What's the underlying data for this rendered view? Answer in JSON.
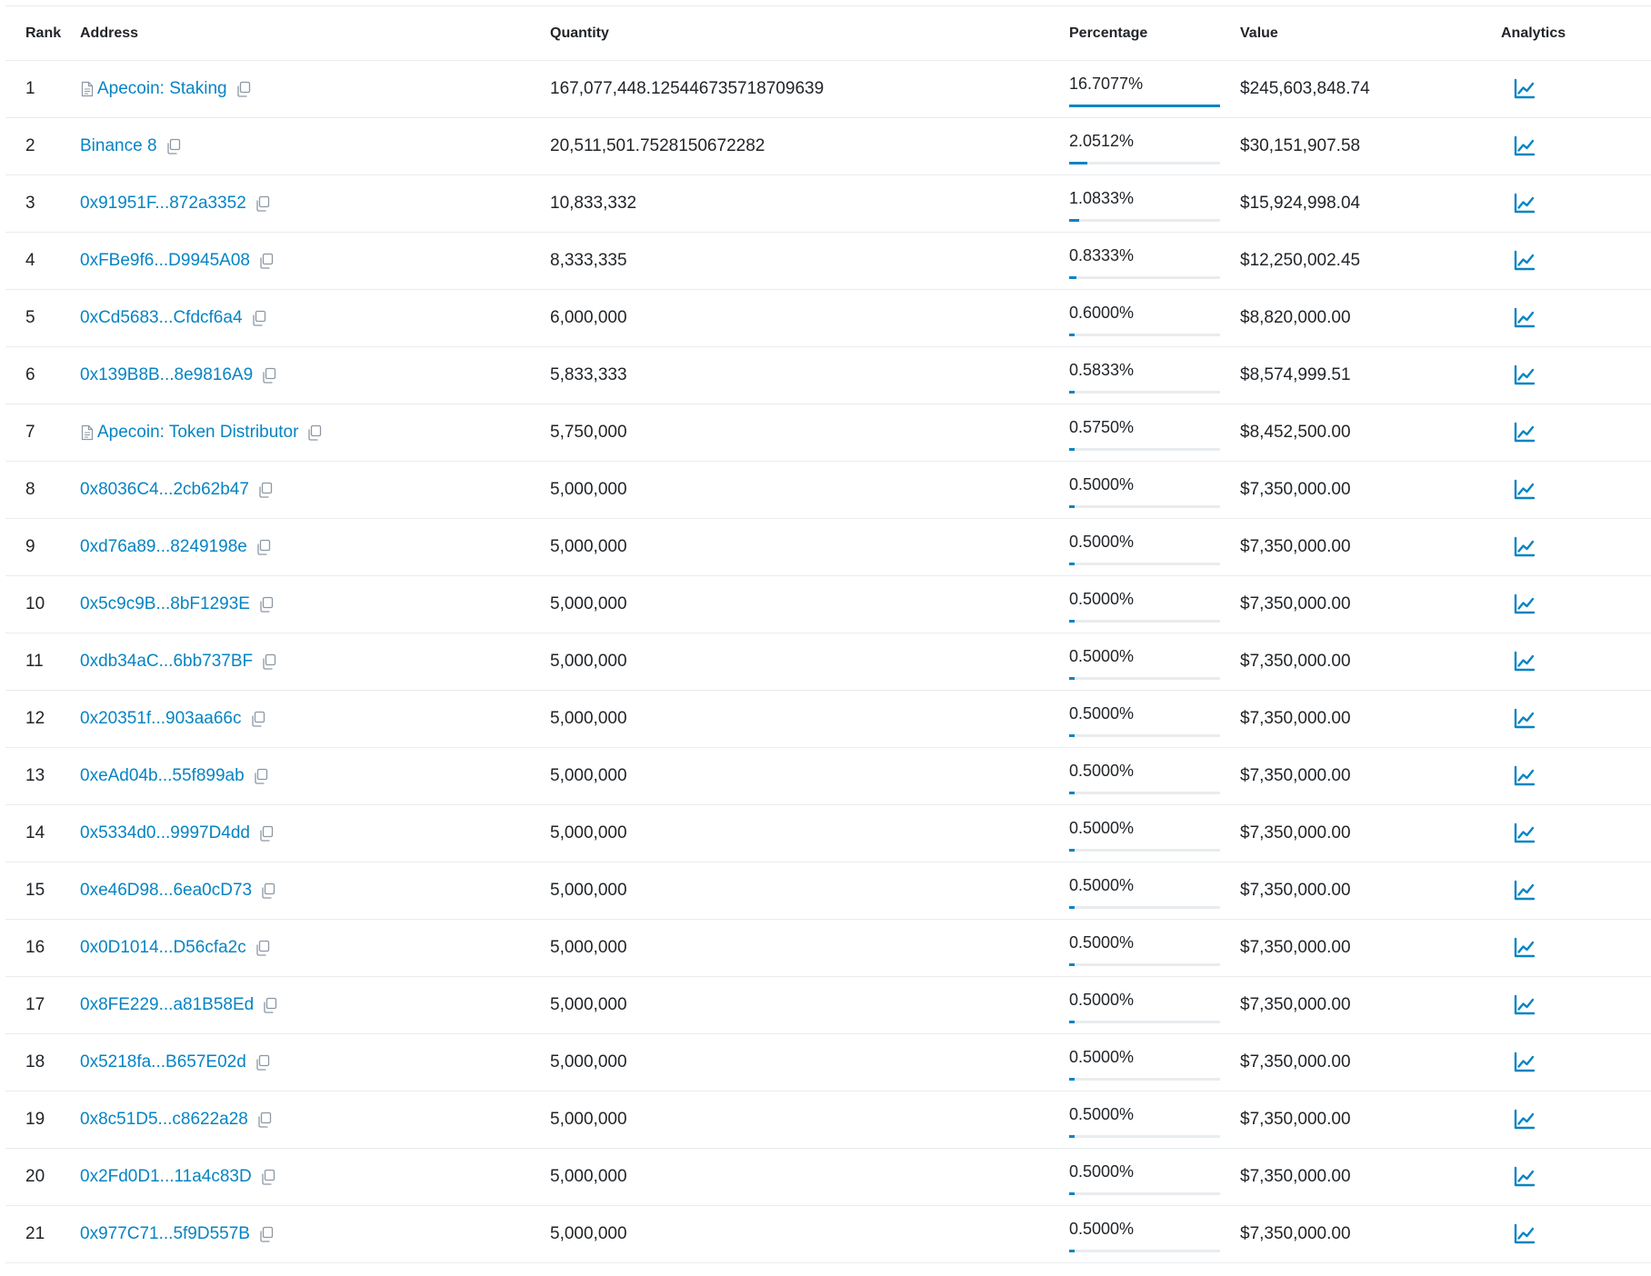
{
  "table": {
    "headers": {
      "rank": "Rank",
      "address": "Address",
      "quantity": "Quantity",
      "percentage": "Percentage",
      "value": "Value",
      "analytics": "Analytics"
    },
    "rows": [
      {
        "rank": "1",
        "address": "Apecoin: Staking",
        "is_contract": true,
        "quantity": "167,077,448.125446735718709639",
        "percentage": "16.7077%",
        "pct_value": 16.7077,
        "value": "$245,603,848.74"
      },
      {
        "rank": "2",
        "address": "Binance 8",
        "is_contract": false,
        "quantity": "20,511,501.7528150672282",
        "percentage": "2.0512%",
        "pct_value": 2.0512,
        "value": "$30,151,907.58"
      },
      {
        "rank": "3",
        "address": "0x91951F...872a3352",
        "is_contract": false,
        "quantity": "10,833,332",
        "percentage": "1.0833%",
        "pct_value": 1.0833,
        "value": "$15,924,998.04"
      },
      {
        "rank": "4",
        "address": "0xFBe9f6...D9945A08",
        "is_contract": false,
        "quantity": "8,333,335",
        "percentage": "0.8333%",
        "pct_value": 0.8333,
        "value": "$12,250,002.45"
      },
      {
        "rank": "5",
        "address": "0xCd5683...Cfdcf6a4",
        "is_contract": false,
        "quantity": "6,000,000",
        "percentage": "0.6000%",
        "pct_value": 0.6,
        "value": "$8,820,000.00"
      },
      {
        "rank": "6",
        "address": "0x139B8B...8e9816A9",
        "is_contract": false,
        "quantity": "5,833,333",
        "percentage": "0.5833%",
        "pct_value": 0.5833,
        "value": "$8,574,999.51"
      },
      {
        "rank": "7",
        "address": "Apecoin: Token Distributor",
        "is_contract": true,
        "quantity": "5,750,000",
        "percentage": "0.5750%",
        "pct_value": 0.575,
        "value": "$8,452,500.00"
      },
      {
        "rank": "8",
        "address": "0x8036C4...2cb62b47",
        "is_contract": false,
        "quantity": "5,000,000",
        "percentage": "0.5000%",
        "pct_value": 0.5,
        "value": "$7,350,000.00"
      },
      {
        "rank": "9",
        "address": "0xd76a89...8249198e",
        "is_contract": false,
        "quantity": "5,000,000",
        "percentage": "0.5000%",
        "pct_value": 0.5,
        "value": "$7,350,000.00"
      },
      {
        "rank": "10",
        "address": "0x5c9c9B...8bF1293E",
        "is_contract": false,
        "quantity": "5,000,000",
        "percentage": "0.5000%",
        "pct_value": 0.5,
        "value": "$7,350,000.00"
      },
      {
        "rank": "11",
        "address": "0xdb34aC...6bb737BF",
        "is_contract": false,
        "quantity": "5,000,000",
        "percentage": "0.5000%",
        "pct_value": 0.5,
        "value": "$7,350,000.00"
      },
      {
        "rank": "12",
        "address": "0x20351f...903aa66c",
        "is_contract": false,
        "quantity": "5,000,000",
        "percentage": "0.5000%",
        "pct_value": 0.5,
        "value": "$7,350,000.00"
      },
      {
        "rank": "13",
        "address": "0xeAd04b...55f899ab",
        "is_contract": false,
        "quantity": "5,000,000",
        "percentage": "0.5000%",
        "pct_value": 0.5,
        "value": "$7,350,000.00"
      },
      {
        "rank": "14",
        "address": "0x5334d0...9997D4dd",
        "is_contract": false,
        "quantity": "5,000,000",
        "percentage": "0.5000%",
        "pct_value": 0.5,
        "value": "$7,350,000.00"
      },
      {
        "rank": "15",
        "address": "0xe46D98...6ea0cD73",
        "is_contract": false,
        "quantity": "5,000,000",
        "percentage": "0.5000%",
        "pct_value": 0.5,
        "value": "$7,350,000.00"
      },
      {
        "rank": "16",
        "address": "0x0D1014...D56cfa2c",
        "is_contract": false,
        "quantity": "5,000,000",
        "percentage": "0.5000%",
        "pct_value": 0.5,
        "value": "$7,350,000.00"
      },
      {
        "rank": "17",
        "address": "0x8FE229...a81B58Ed",
        "is_contract": false,
        "quantity": "5,000,000",
        "percentage": "0.5000%",
        "pct_value": 0.5,
        "value": "$7,350,000.00"
      },
      {
        "rank": "18",
        "address": "0x5218fa...B657E02d",
        "is_contract": false,
        "quantity": "5,000,000",
        "percentage": "0.5000%",
        "pct_value": 0.5,
        "value": "$7,350,000.00"
      },
      {
        "rank": "19",
        "address": "0x8c51D5...c8622a28",
        "is_contract": false,
        "quantity": "5,000,000",
        "percentage": "0.5000%",
        "pct_value": 0.5,
        "value": "$7,350,000.00"
      },
      {
        "rank": "20",
        "address": "0x2Fd0D1...11a4c83D",
        "is_contract": false,
        "quantity": "5,000,000",
        "percentage": "0.5000%",
        "pct_value": 0.5,
        "value": "$7,350,000.00"
      },
      {
        "rank": "21",
        "address": "0x977C71...5f9D557B",
        "is_contract": false,
        "quantity": "5,000,000",
        "percentage": "0.5000%",
        "pct_value": 0.5,
        "value": "$7,350,000.00"
      }
    ]
  },
  "icons": {
    "contract": "file-icon",
    "copy": "copy-icon",
    "analytics": "analytics-chart-icon"
  },
  "colors": {
    "link": "#0784c3",
    "bar_track": "#e9ecef",
    "bar_fill": "#0784c3",
    "text": "#212529"
  }
}
